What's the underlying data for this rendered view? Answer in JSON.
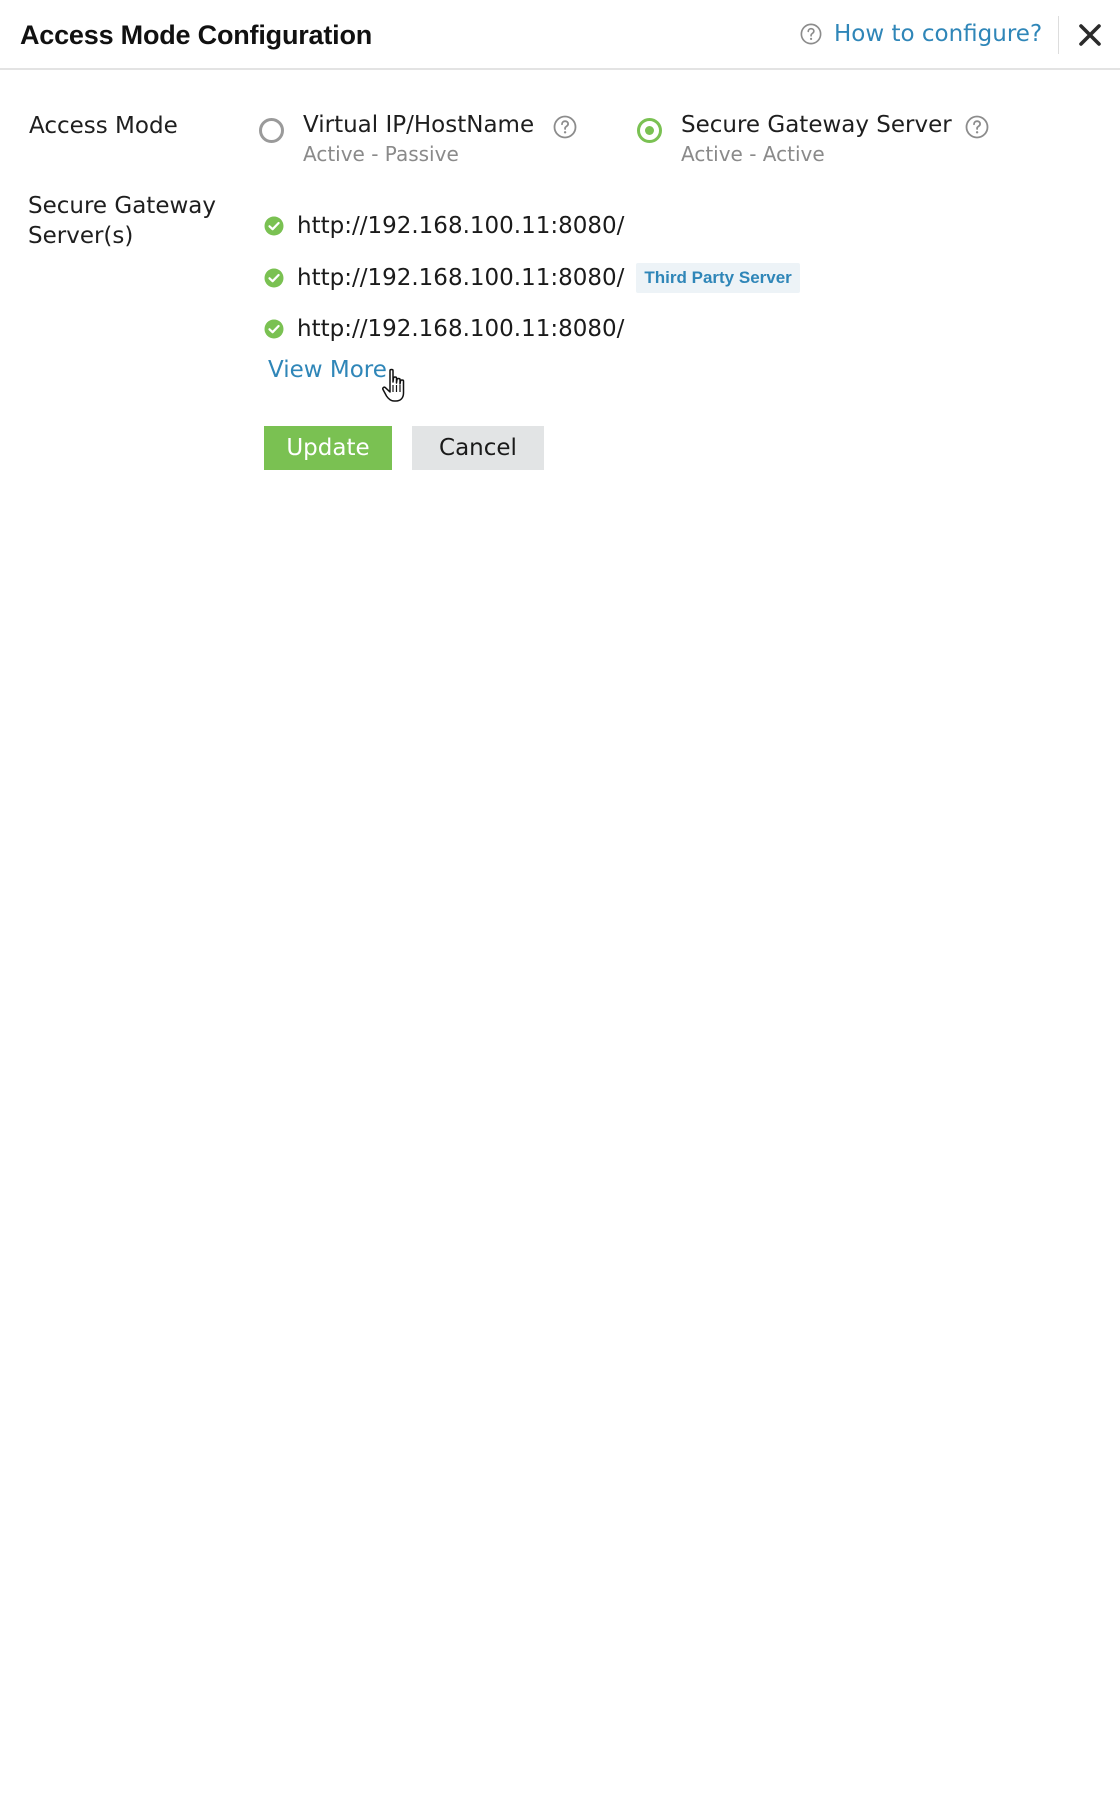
{
  "header": {
    "title": "Access Mode Configuration",
    "help_link": "How to configure?"
  },
  "form": {
    "access_mode": {
      "label": "Access Mode",
      "options": [
        {
          "title": "Virtual IP/HostName",
          "subtitle": "Active - Passive",
          "selected": false
        },
        {
          "title": "Secure Gateway Server",
          "subtitle": "Active - Active",
          "selected": true
        }
      ]
    },
    "servers": {
      "label": "Secure Gateway Server(s)",
      "items": [
        {
          "url": "http://192.168.100.11:8080/",
          "status": "ok",
          "badge": ""
        },
        {
          "url": "http://192.168.100.11:8080/",
          "status": "ok",
          "badge": "Third Party Server"
        },
        {
          "url": "http://192.168.100.11:8080/",
          "status": "ok",
          "badge": ""
        }
      ],
      "view_more": "View More"
    },
    "buttons": {
      "update": "Update",
      "cancel": "Cancel"
    }
  },
  "colors": {
    "accent_green": "#7ac152",
    "link_blue": "#2f86b8",
    "subtitle_gray": "#8a8a8a"
  }
}
